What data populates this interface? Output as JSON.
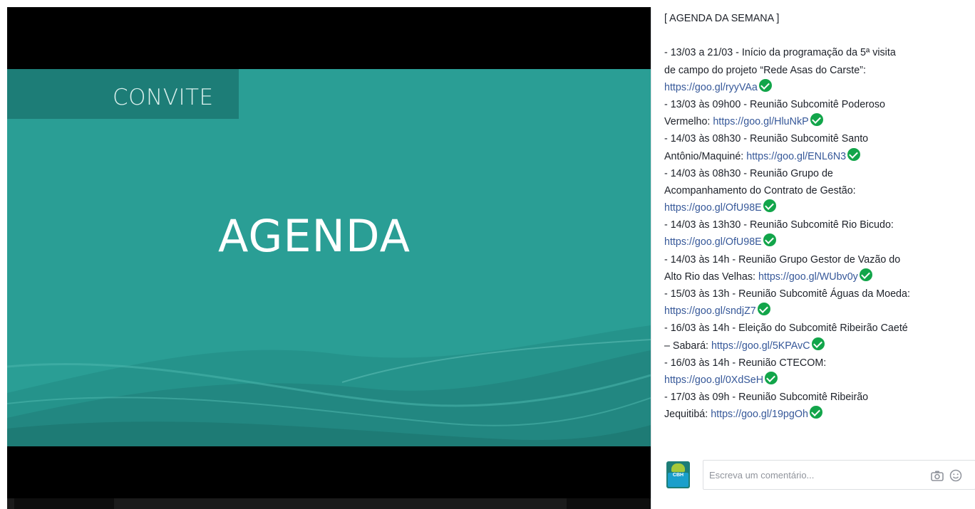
{
  "slide": {
    "tag": "CONVITE",
    "title": "AGENDA",
    "colors": {
      "background": "#2a9e95",
      "tag_box": "#1d7d77",
      "viewer": "#000000"
    }
  },
  "post": {
    "lines": [
      {
        "text": "[ AGENDA DA SEMANA ]"
      },
      {
        "text": ""
      },
      {
        "text": "- 13/03 a 21/03 - Início da programação da 5ª visita"
      },
      {
        "text": "de campo do projeto “Rede Asas do Carste”:"
      },
      {
        "text": "",
        "link": "https://goo.gl/ryyVAa",
        "check": true
      },
      {
        "text": "- 13/03 às 09h00 - Reunião Subcomitê Poderoso"
      },
      {
        "text": "Vermelho: ",
        "link": "https://goo.gl/HluNkP",
        "check": true
      },
      {
        "text": "- 14/03 às 08h30 - Reunião Subcomitê Santo"
      },
      {
        "text": "Antônio/Maquiné: ",
        "link": "https://goo.gl/ENL6N3",
        "check": true
      },
      {
        "text": "- 14/03 às 08h30 - Reunião Grupo de"
      },
      {
        "text": "Acompanhamento do Contrato de Gestão:"
      },
      {
        "text": "",
        "link": "https://goo.gl/OfU98E",
        "check": true
      },
      {
        "text": "- 14/03 às 13h30 - Reunião Subcomitê Rio Bicudo:"
      },
      {
        "text": "",
        "link": "https://goo.gl/OfU98E",
        "check": true
      },
      {
        "text": "- 14/03 às 14h - Reunião Grupo Gestor de Vazão do"
      },
      {
        "text": "Alto Rio das Velhas: ",
        "link": "https://goo.gl/WUbv0y",
        "check": true
      },
      {
        "text": "- 15/03 às 13h - Reunião Subcomitê Águas da Moeda:"
      },
      {
        "text": "",
        "link": "https://goo.gl/sndjZ7",
        "check": true
      },
      {
        "text": "- 16/03 às 14h - Eleição do Subcomitê Ribeirão Caeté"
      },
      {
        "text": "– Sabará: ",
        "link": "https://goo.gl/5KPAvC",
        "check": true
      },
      {
        "text": "- 16/03 às 14h - Reunião CTECOM:"
      },
      {
        "text": "",
        "link": "https://goo.gl/0XdSeH",
        "check": true
      },
      {
        "text": "- 17/03 às 09h - Reunião Subcomitê Ribeirão"
      },
      {
        "text": "Jequitibá: ",
        "link": "https://goo.gl/19pgOh",
        "check": true
      }
    ],
    "link_color": "#365899",
    "check_color": "#12a54a"
  },
  "comment": {
    "avatar_label": "CBH",
    "placeholder": "Escreva um comentário...",
    "icons": [
      "camera-icon",
      "smiley-icon"
    ]
  }
}
